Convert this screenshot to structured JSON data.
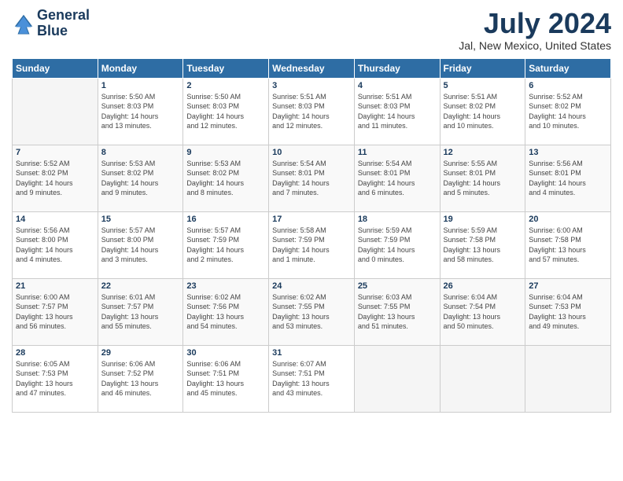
{
  "header": {
    "logo_line1": "General",
    "logo_line2": "Blue",
    "month_title": "July 2024",
    "location": "Jal, New Mexico, United States"
  },
  "weekdays": [
    "Sunday",
    "Monday",
    "Tuesday",
    "Wednesday",
    "Thursday",
    "Friday",
    "Saturday"
  ],
  "weeks": [
    {
      "days": [
        {
          "num": "",
          "info": ""
        },
        {
          "num": "1",
          "info": "Sunrise: 5:50 AM\nSunset: 8:03 PM\nDaylight: 14 hours\nand 13 minutes."
        },
        {
          "num": "2",
          "info": "Sunrise: 5:50 AM\nSunset: 8:03 PM\nDaylight: 14 hours\nand 12 minutes."
        },
        {
          "num": "3",
          "info": "Sunrise: 5:51 AM\nSunset: 8:03 PM\nDaylight: 14 hours\nand 12 minutes."
        },
        {
          "num": "4",
          "info": "Sunrise: 5:51 AM\nSunset: 8:03 PM\nDaylight: 14 hours\nand 11 minutes."
        },
        {
          "num": "5",
          "info": "Sunrise: 5:51 AM\nSunset: 8:02 PM\nDaylight: 14 hours\nand 10 minutes."
        },
        {
          "num": "6",
          "info": "Sunrise: 5:52 AM\nSunset: 8:02 PM\nDaylight: 14 hours\nand 10 minutes."
        }
      ]
    },
    {
      "days": [
        {
          "num": "7",
          "info": "Sunrise: 5:52 AM\nSunset: 8:02 PM\nDaylight: 14 hours\nand 9 minutes."
        },
        {
          "num": "8",
          "info": "Sunrise: 5:53 AM\nSunset: 8:02 PM\nDaylight: 14 hours\nand 9 minutes."
        },
        {
          "num": "9",
          "info": "Sunrise: 5:53 AM\nSunset: 8:02 PM\nDaylight: 14 hours\nand 8 minutes."
        },
        {
          "num": "10",
          "info": "Sunrise: 5:54 AM\nSunset: 8:01 PM\nDaylight: 14 hours\nand 7 minutes."
        },
        {
          "num": "11",
          "info": "Sunrise: 5:54 AM\nSunset: 8:01 PM\nDaylight: 14 hours\nand 6 minutes."
        },
        {
          "num": "12",
          "info": "Sunrise: 5:55 AM\nSunset: 8:01 PM\nDaylight: 14 hours\nand 5 minutes."
        },
        {
          "num": "13",
          "info": "Sunrise: 5:56 AM\nSunset: 8:01 PM\nDaylight: 14 hours\nand 4 minutes."
        }
      ]
    },
    {
      "days": [
        {
          "num": "14",
          "info": "Sunrise: 5:56 AM\nSunset: 8:00 PM\nDaylight: 14 hours\nand 4 minutes."
        },
        {
          "num": "15",
          "info": "Sunrise: 5:57 AM\nSunset: 8:00 PM\nDaylight: 14 hours\nand 3 minutes."
        },
        {
          "num": "16",
          "info": "Sunrise: 5:57 AM\nSunset: 7:59 PM\nDaylight: 14 hours\nand 2 minutes."
        },
        {
          "num": "17",
          "info": "Sunrise: 5:58 AM\nSunset: 7:59 PM\nDaylight: 14 hours\nand 1 minute."
        },
        {
          "num": "18",
          "info": "Sunrise: 5:59 AM\nSunset: 7:59 PM\nDaylight: 14 hours\nand 0 minutes."
        },
        {
          "num": "19",
          "info": "Sunrise: 5:59 AM\nSunset: 7:58 PM\nDaylight: 13 hours\nand 58 minutes."
        },
        {
          "num": "20",
          "info": "Sunrise: 6:00 AM\nSunset: 7:58 PM\nDaylight: 13 hours\nand 57 minutes."
        }
      ]
    },
    {
      "days": [
        {
          "num": "21",
          "info": "Sunrise: 6:00 AM\nSunset: 7:57 PM\nDaylight: 13 hours\nand 56 minutes."
        },
        {
          "num": "22",
          "info": "Sunrise: 6:01 AM\nSunset: 7:57 PM\nDaylight: 13 hours\nand 55 minutes."
        },
        {
          "num": "23",
          "info": "Sunrise: 6:02 AM\nSunset: 7:56 PM\nDaylight: 13 hours\nand 54 minutes."
        },
        {
          "num": "24",
          "info": "Sunrise: 6:02 AM\nSunset: 7:55 PM\nDaylight: 13 hours\nand 53 minutes."
        },
        {
          "num": "25",
          "info": "Sunrise: 6:03 AM\nSunset: 7:55 PM\nDaylight: 13 hours\nand 51 minutes."
        },
        {
          "num": "26",
          "info": "Sunrise: 6:04 AM\nSunset: 7:54 PM\nDaylight: 13 hours\nand 50 minutes."
        },
        {
          "num": "27",
          "info": "Sunrise: 6:04 AM\nSunset: 7:53 PM\nDaylight: 13 hours\nand 49 minutes."
        }
      ]
    },
    {
      "days": [
        {
          "num": "28",
          "info": "Sunrise: 6:05 AM\nSunset: 7:53 PM\nDaylight: 13 hours\nand 47 minutes."
        },
        {
          "num": "29",
          "info": "Sunrise: 6:06 AM\nSunset: 7:52 PM\nDaylight: 13 hours\nand 46 minutes."
        },
        {
          "num": "30",
          "info": "Sunrise: 6:06 AM\nSunset: 7:51 PM\nDaylight: 13 hours\nand 45 minutes."
        },
        {
          "num": "31",
          "info": "Sunrise: 6:07 AM\nSunset: 7:51 PM\nDaylight: 13 hours\nand 43 minutes."
        },
        {
          "num": "",
          "info": ""
        },
        {
          "num": "",
          "info": ""
        },
        {
          "num": "",
          "info": ""
        }
      ]
    }
  ]
}
